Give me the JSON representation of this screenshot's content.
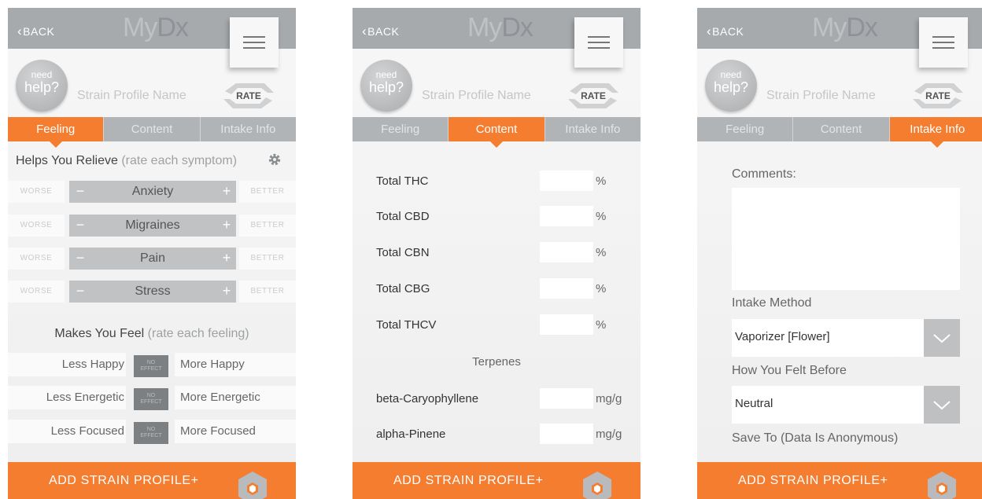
{
  "common": {
    "back_label": "BACK",
    "back_chevron": "‹",
    "logo_light": "My",
    "logo_dark": "Dx",
    "help_small": "need",
    "help_big": "help?",
    "profile_name_placeholder": "Strain Profile Name",
    "rate_label": "RATE",
    "tabs": [
      "Feeling",
      "Content",
      "Intake Info"
    ],
    "add_button_label": "ADD STRAIN PROFILE+",
    "colors": {
      "accent": "#f47d30",
      "header": "#a7aaad",
      "tab_inactive": "#b1b4b7"
    }
  },
  "feeling": {
    "relieve_title": "Helps You Relieve",
    "relieve_hint": "(rate each symptom)",
    "worse_label": "WORSE",
    "better_label": "BETTER",
    "symptoms": [
      "Anxiety",
      "Migraines",
      "Pain",
      "Stress"
    ],
    "feel_title": "Makes You Feel",
    "feel_hint": "(rate each feeling)",
    "no_effect_label_1": "NO",
    "no_effect_label_2": "EFFECT",
    "feelings": [
      {
        "less": "Less Happy",
        "more": "More Happy"
      },
      {
        "less": "Less Energetic",
        "more": "More Energetic"
      },
      {
        "less": "Less Focused",
        "more": "More Focused"
      }
    ]
  },
  "content": {
    "rows": [
      {
        "label": "Total THC",
        "unit": "%"
      },
      {
        "label": "Total CBD",
        "unit": "%"
      },
      {
        "label": "Total CBN",
        "unit": "%"
      },
      {
        "label": "Total CBG",
        "unit": "%"
      },
      {
        "label": "Total THCV",
        "unit": "%"
      }
    ],
    "terpenes_title": "Terpenes",
    "terpenes": [
      {
        "label": "beta-Caryophyllene",
        "unit": "mg/g"
      },
      {
        "label": "alpha-Pinene",
        "unit": "mg/g"
      }
    ]
  },
  "intake": {
    "comments_label": "Comments:",
    "intake_method_label": "Intake Method",
    "intake_method_value": "Vaporizer [Flower]",
    "felt_before_label": "How You Felt Before",
    "felt_before_value": "Neutral",
    "save_to_label": "Save To (Data Is Anonymous)"
  }
}
